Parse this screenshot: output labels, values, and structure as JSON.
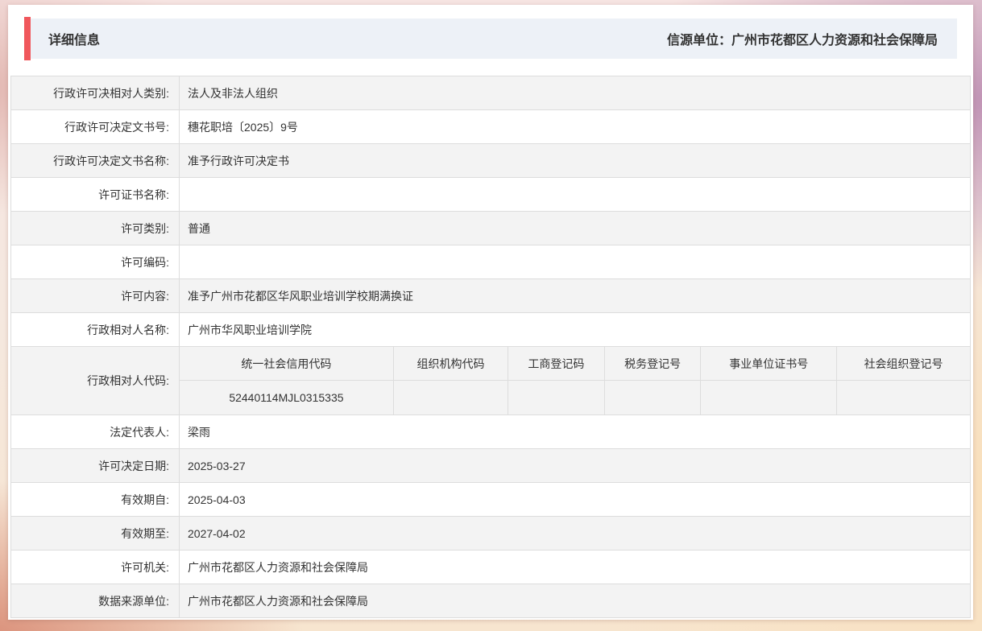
{
  "header": {
    "title": "详细信息",
    "source": "信源单位：广州市花都区人力资源和社会保障局"
  },
  "colors": {
    "accent_red": "#f0575c",
    "header_band": "#edf1f7",
    "row_stripe": "#f3f3f3",
    "border": "#dddddd",
    "text": "#333333"
  },
  "rows": [
    {
      "label": "行政许可决相对人类别:",
      "value": "法人及非法人组织"
    },
    {
      "label": "行政许可决定文书号:",
      "value": "穗花职培〔2025〕9号"
    },
    {
      "label": "行政许可决定文书名称:",
      "value": "准予行政许可决定书"
    },
    {
      "label": "许可证书名称:",
      "value": ""
    },
    {
      "label": "许可类别:",
      "value": "普通"
    },
    {
      "label": "许可编码:",
      "value": ""
    },
    {
      "label": "许可内容:",
      "value": "准予广州市花都区华风职业培训学校期满换证"
    },
    {
      "label": "行政相对人名称:",
      "value": "广州市华风职业培训学院"
    },
    {
      "label": "法定代表人:",
      "value": "梁雨"
    },
    {
      "label": "许可决定日期:",
      "value": "2025-03-27"
    },
    {
      "label": "有效期自:",
      "value": "2025-04-03"
    },
    {
      "label": "有效期至:",
      "value": "2027-04-02"
    },
    {
      "label": "许可机关:",
      "value": "广州市花都区人力资源和社会保障局"
    },
    {
      "label": "数据来源单位:",
      "value": "广州市花都区人力资源和社会保障局"
    }
  ],
  "codes": {
    "label": "行政相对人代码:",
    "columns": [
      "统一社会信用代码",
      "组织机构代码",
      "工商登记码",
      "税务登记号",
      "事业单位证书号",
      "社会组织登记号"
    ],
    "values": [
      "52440114MJL0315335",
      "",
      "",
      "",
      "",
      ""
    ]
  }
}
